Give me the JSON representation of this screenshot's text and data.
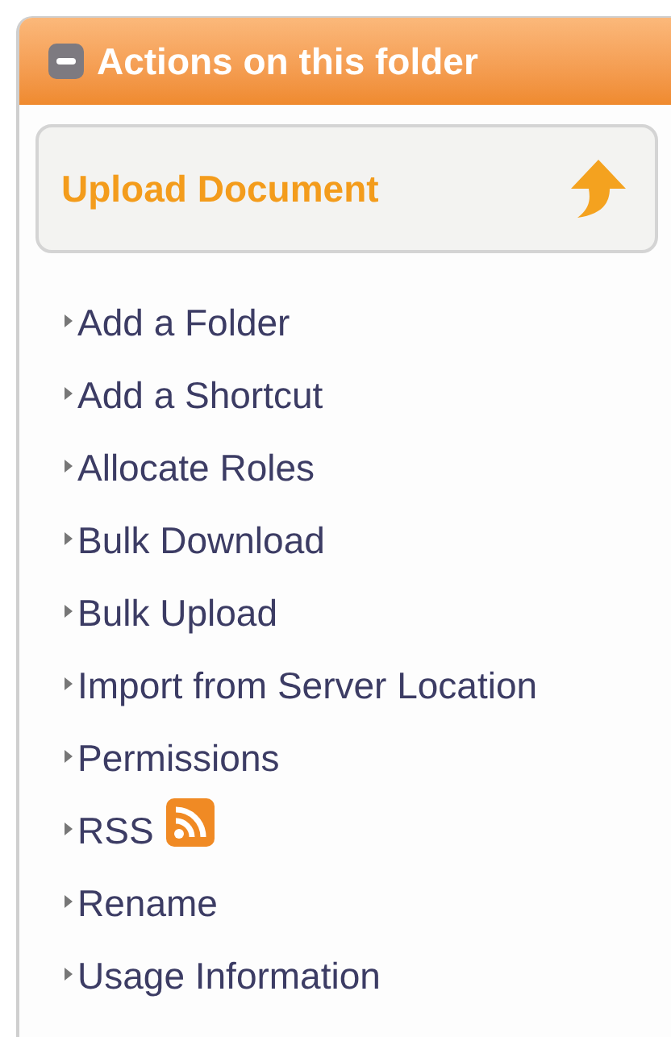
{
  "panel": {
    "title": "Actions on this folder",
    "expanded": true
  },
  "primary_action": {
    "label": "Upload Document"
  },
  "actions": [
    {
      "label": "Add a Folder",
      "kind": "link"
    },
    {
      "label": "Add a Shortcut",
      "kind": "link"
    },
    {
      "label": "Allocate Roles",
      "kind": "link"
    },
    {
      "label": "Bulk Download",
      "kind": "link"
    },
    {
      "label": "Bulk Upload",
      "kind": "link"
    },
    {
      "label": "Import from Server Location",
      "kind": "link"
    },
    {
      "label": "Permissions",
      "kind": "link"
    },
    {
      "label": "RSS",
      "kind": "feed"
    },
    {
      "label": "Rename",
      "kind": "link"
    },
    {
      "label": "Usage Information",
      "kind": "link"
    }
  ]
}
